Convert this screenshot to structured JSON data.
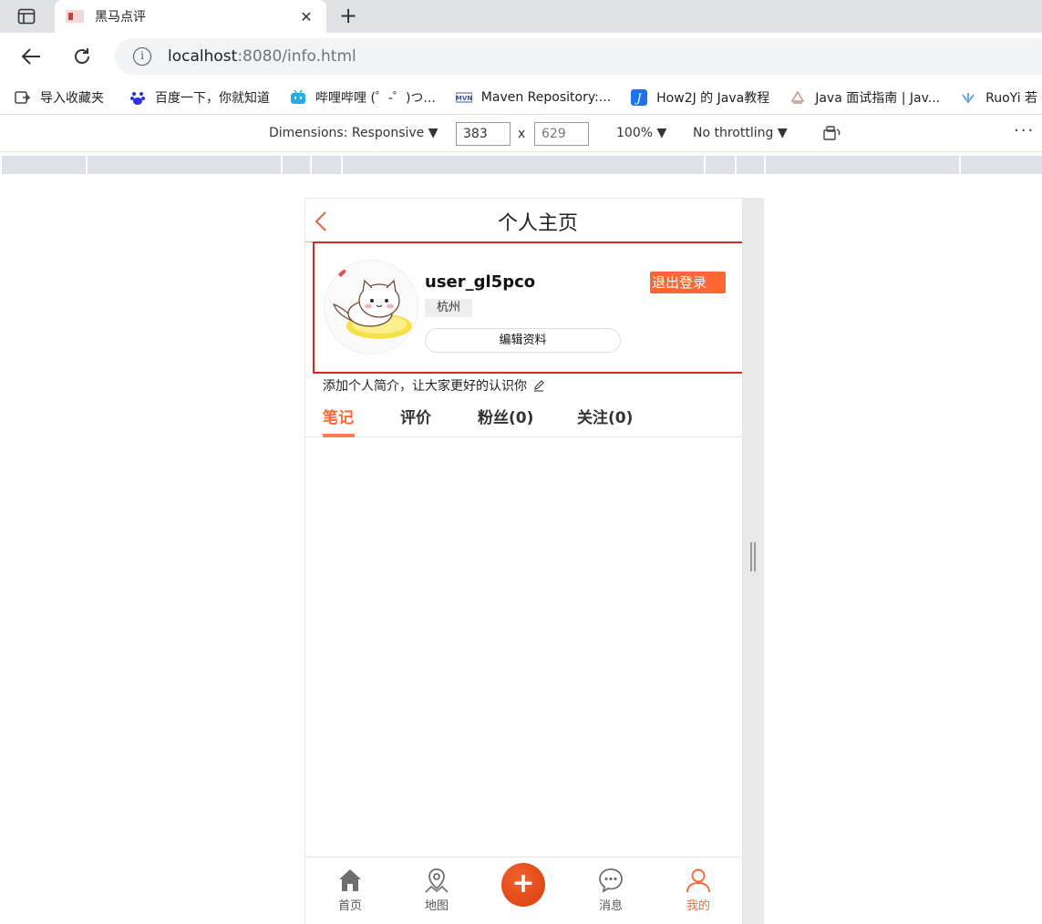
{
  "browser": {
    "tab_title": "黑马点评",
    "tab_close": "✕",
    "new_tab": "+",
    "url_host": "localhost",
    "url_rest": ":8080/info.html",
    "info_glyph": "i",
    "bookmarks": [
      {
        "label": "导入收藏夹",
        "icon": "import-bookmarks-icon",
        "color": "#444444"
      },
      {
        "label": "百度一下，你就知道",
        "icon": "baidu-icon",
        "color": "#2932e1"
      },
      {
        "label": "哔哩哔哩 (゜-゜)つ...",
        "icon": "bilibili-icon",
        "color": "#23ade5"
      },
      {
        "label": "Maven Repository:...",
        "icon": "maven-icon",
        "color": "#3b5998"
      },
      {
        "label": "How2J 的 Java教程",
        "icon": "how2j-icon",
        "color": "#1a73e8"
      },
      {
        "label": "Java 面试指南 | Jav...",
        "icon": "javaguide-icon",
        "color": "#c9a7a7"
      },
      {
        "label": "RuoYi 若",
        "icon": "ruoyi-icon",
        "color": "#3b8fd0"
      }
    ]
  },
  "devtools": {
    "dimensions_label": "Dimensions: Responsive ▼",
    "width": "383",
    "height": "629",
    "times": "x",
    "zoom": "100% ▼",
    "throttling": "No throttling ▼",
    "more": "···"
  },
  "page": {
    "header_title": "个人主页",
    "username": "user_gl5pco",
    "city": "杭州",
    "edit_profile": "编辑资料",
    "logout": "退出登录",
    "bio_placeholder": "添加个人简介，让大家更好的认识你",
    "tabs": [
      {
        "label": "笔记",
        "active": true
      },
      {
        "label": "评价",
        "active": false
      },
      {
        "label": "粉丝(0)",
        "active": false
      },
      {
        "label": "关注(0)",
        "active": false
      }
    ],
    "bottom_nav": [
      {
        "label": "首页",
        "icon": "home-icon",
        "active": false
      },
      {
        "label": "地图",
        "icon": "map-pin-icon",
        "active": false
      },
      {
        "label": "消息",
        "icon": "chat-icon",
        "active": false
      },
      {
        "label": "我的",
        "icon": "user-icon",
        "active": true
      }
    ],
    "plus": "+"
  },
  "colors": {
    "accent": "#ff6633",
    "highlight_box": "#d6262a"
  }
}
